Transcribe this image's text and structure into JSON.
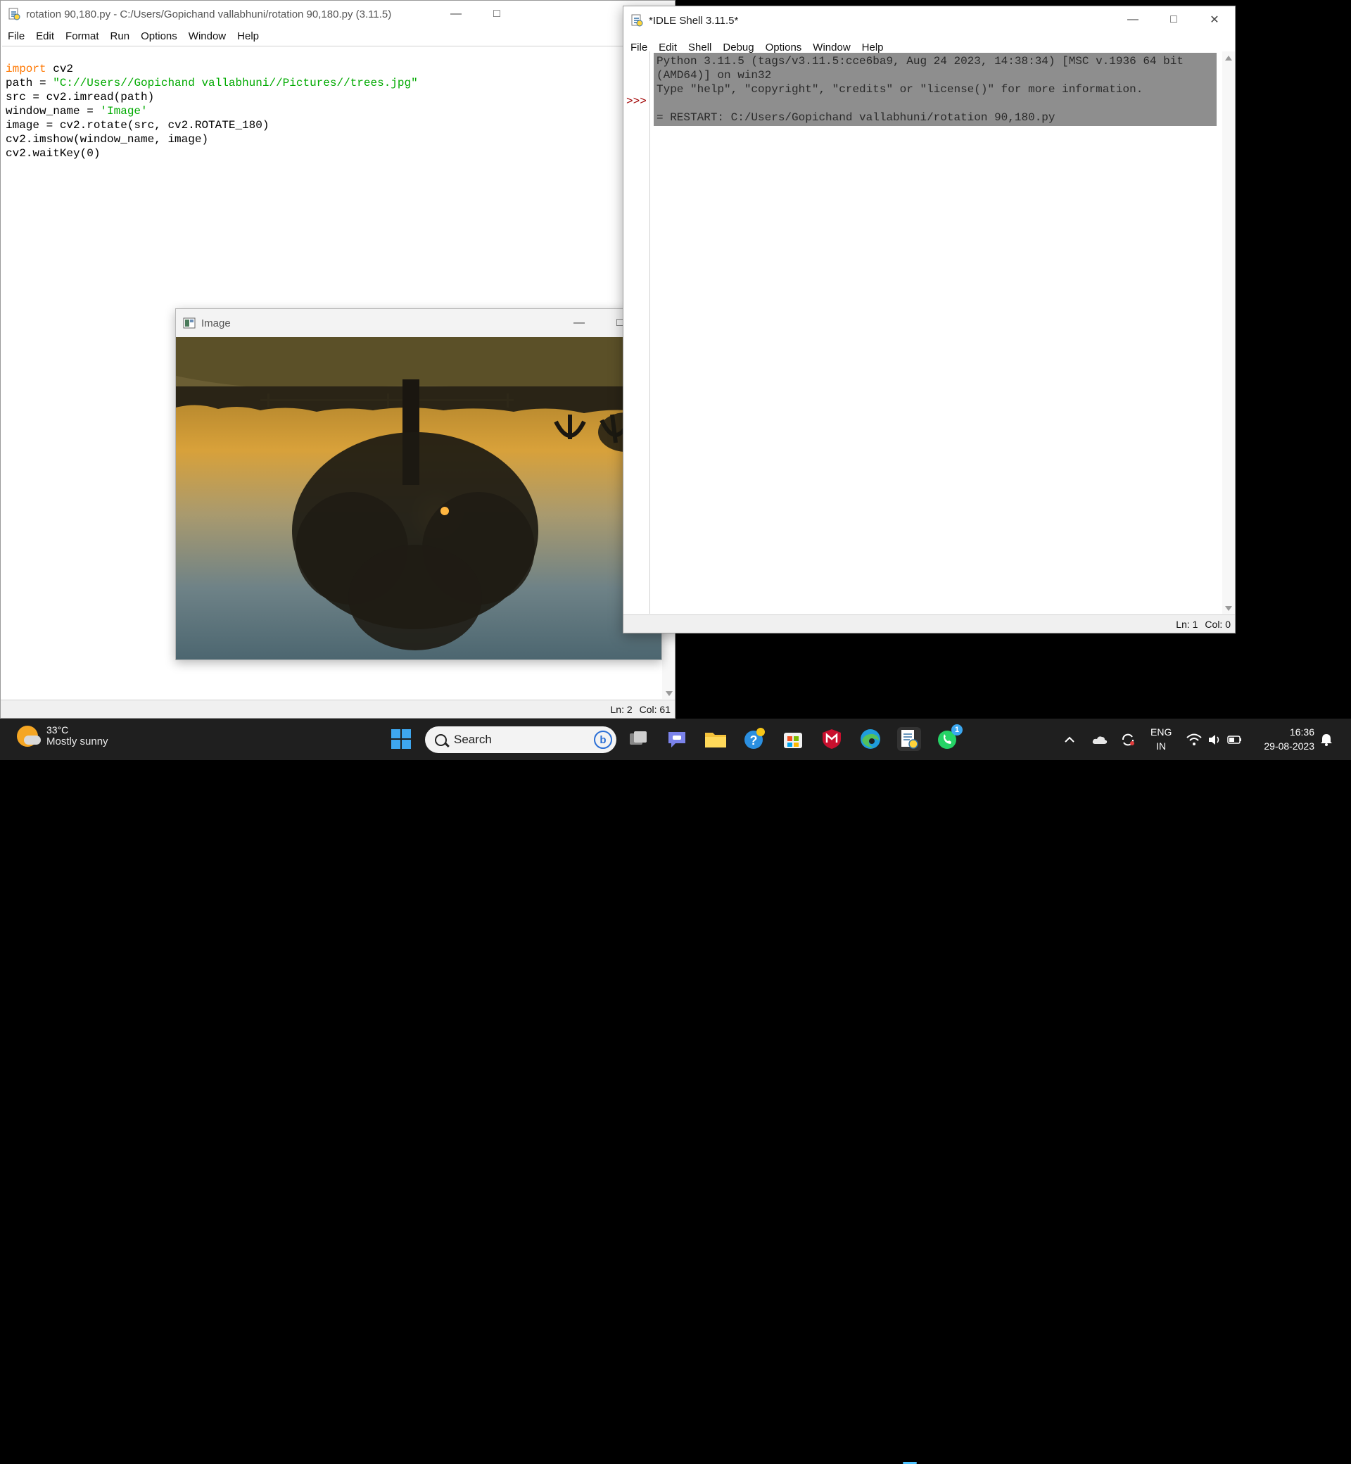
{
  "editor": {
    "title": "rotation 90,180.py - C:/Users/Gopichand vallabhuni/rotation 90,180.py (3.11.5)",
    "menu": [
      "File",
      "Edit",
      "Format",
      "Run",
      "Options",
      "Window",
      "Help"
    ],
    "code": [
      {
        "kw": "import",
        "rest": " cv2"
      },
      {
        "pre": "path = ",
        "str": "\"C://Users//Gopichand vallabhuni//Pictures//trees.jpg\""
      },
      {
        "plain": "src = cv2.imread(path)"
      },
      {
        "pre": "window_name = ",
        "str": "'Image'"
      },
      {
        "plain": "image = cv2.rotate(src, cv2.ROTATE_180)"
      },
      {
        "plain": "cv2.imshow(window_name, image)"
      },
      {
        "plain": "cv2.waitKey(0)"
      }
    ],
    "status": {
      "ln": "Ln: 2",
      "col": "Col: 61"
    }
  },
  "image_window": {
    "title": "Image"
  },
  "shell": {
    "title": "*IDLE Shell 3.11.5*",
    "menu": [
      "File",
      "Edit",
      "Shell",
      "Debug",
      "Options",
      "Window",
      "Help"
    ],
    "prompt": ">>>",
    "output": "Python 3.11.5 (tags/v3.11.5:cce6ba9, Aug 24 2023, 14:38:34) [MSC v.1936 64 bit (AMD64)] on win32\nType \"help\", \"copyright\", \"credits\" or \"license()\" for more information.\n\n= RESTART: C:/Users/Gopichand vallabhuni/rotation 90,180.py",
    "status": {
      "ln": "Ln: 1",
      "col": "Col: 0"
    }
  },
  "taskbar": {
    "weather_temp": "33°C",
    "weather_desc": "Mostly sunny",
    "search_label": "Search",
    "lang_top": "ENG",
    "lang_bottom": "IN",
    "time": "16:36",
    "date": "29-08-2023",
    "whatsapp_badge": "1"
  },
  "colors": {
    "keyword": "#ff7700",
    "string": "#00aa00",
    "prompt": "#a00000",
    "shell_selection": "#8e8e8e",
    "taskbar": "#1f1f1f"
  }
}
